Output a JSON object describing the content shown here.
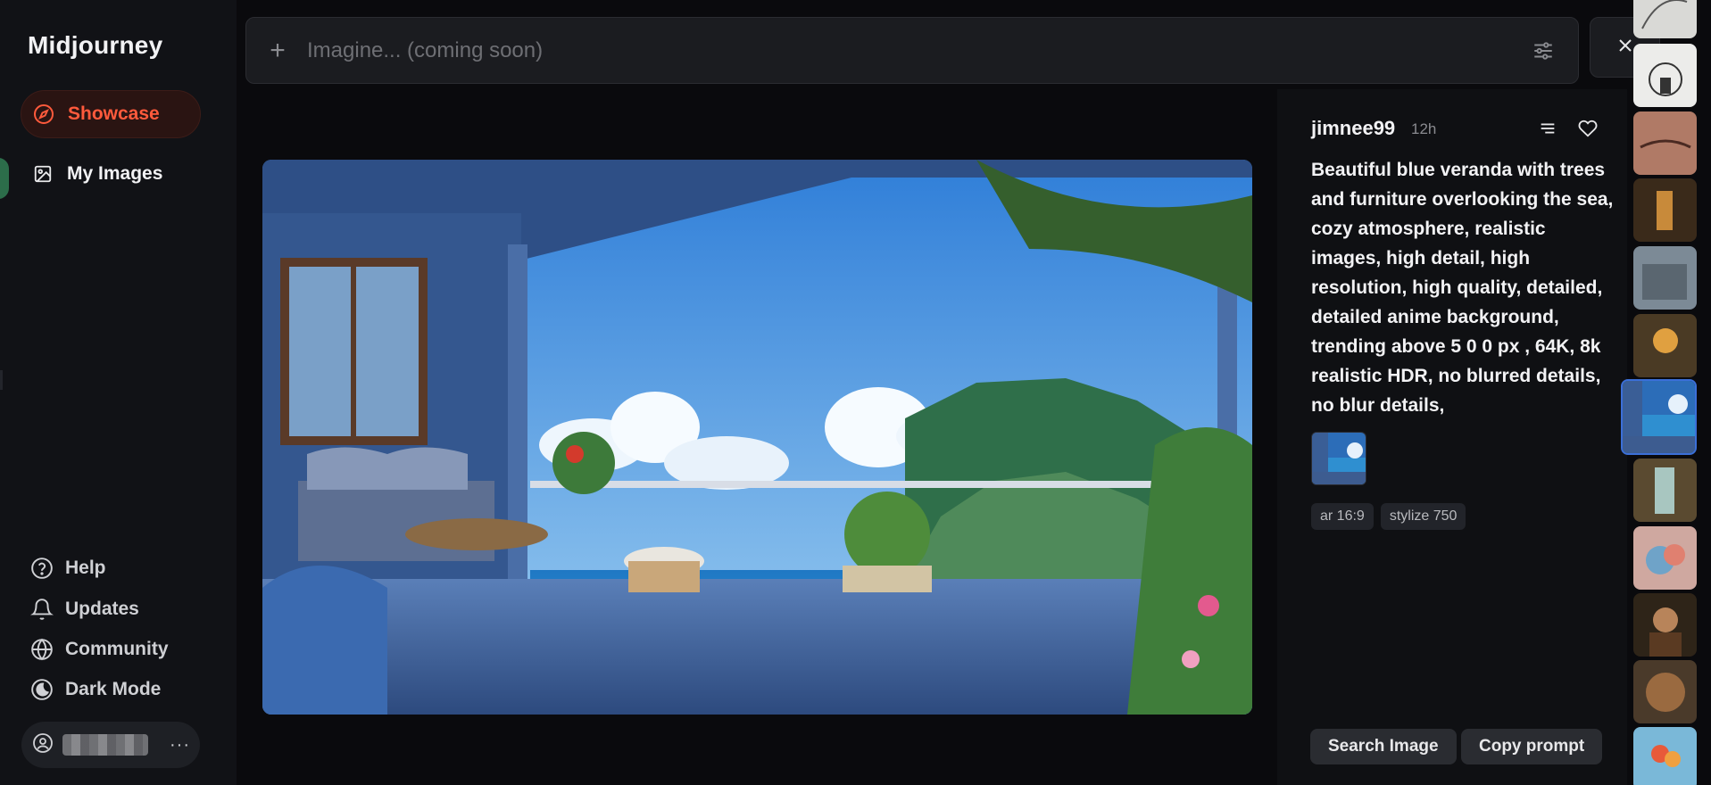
{
  "app": {
    "title": "Midjourney"
  },
  "nav": {
    "showcase": {
      "label": "Showcase",
      "icon": "compass-icon",
      "color": "#ff5a3c"
    },
    "my_images": {
      "label": "My Images",
      "icon": "image-icon"
    }
  },
  "bottom_nav": [
    {
      "label": "Help",
      "icon": "help-circle-icon"
    },
    {
      "label": "Updates",
      "icon": "bell-icon"
    },
    {
      "label": "Community",
      "icon": "globe-icon"
    },
    {
      "label": "Dark Mode",
      "icon": "moon-icon"
    }
  ],
  "user": {
    "more": "···"
  },
  "prompt_bar": {
    "placeholder": "Imagine... (coming soon)"
  },
  "detail": {
    "author": "jimnee99",
    "time": "12h",
    "prompt": "Beautiful blue veranda with trees and furniture overlooking the sea, cozy atmosphere, realistic images, high detail, high resolution, high quality, detailed, detailed anime background, trending above 5 0 0 px , 64K, 8k realistic HDR, no blurred details, no blur details,",
    "tags": [
      "ar 16:9",
      "stylize 750"
    ],
    "search_button": "Search Image",
    "copy_button": "Copy prompt"
  }
}
